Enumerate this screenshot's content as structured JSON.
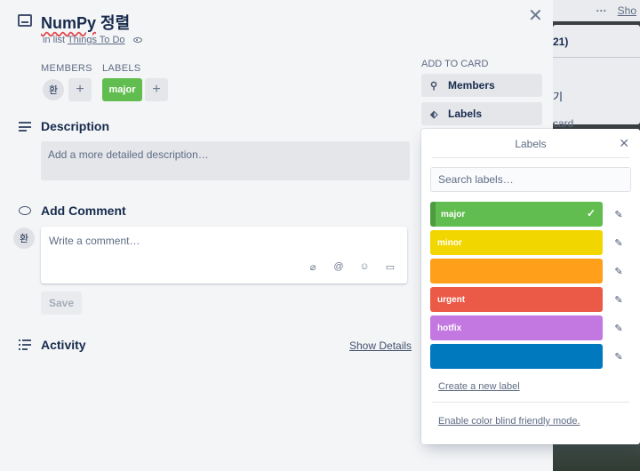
{
  "background": {
    "dots": "···",
    "show_link": "Sho",
    "list_title": "21)",
    "list_line2": "기",
    "list_line3": "card"
  },
  "card": {
    "title_word": "NumPy",
    "title_rest": "정렬",
    "in_list_prefix": "in list",
    "list_name": "Things To Do"
  },
  "members": {
    "label": "MEMBERS",
    "avatar_initial": "환"
  },
  "labels_section": {
    "label": "LABELS",
    "chip": "major",
    "chip_color": "#61bd4f"
  },
  "description": {
    "title": "Description",
    "placeholder": "Add a more detailed description…"
  },
  "comment": {
    "title": "Add Comment",
    "avatar_initial": "환",
    "placeholder": "Write a comment…",
    "save_label": "Save"
  },
  "activity": {
    "title": "Activity",
    "show_details": "Show Details"
  },
  "sidebar": {
    "add_to_card": "ADD TO CARD",
    "members_btn": "Members",
    "labels_btn": "Labels"
  },
  "popover": {
    "title": "Labels",
    "search_placeholder": "Search labels…",
    "labels": [
      {
        "name": "major",
        "color": "#61bd4f",
        "selected": true
      },
      {
        "name": "minor",
        "color": "#f2d600",
        "selected": false
      },
      {
        "name": "",
        "color": "#ff9f1a",
        "selected": false
      },
      {
        "name": "urgent",
        "color": "#eb5a46",
        "selected": false
      },
      {
        "name": "hotfix",
        "color": "#c377e0",
        "selected": false
      },
      {
        "name": "",
        "color": "#0079bf",
        "selected": false
      }
    ],
    "create_link": "Create a new label",
    "colorblind_link": "Enable color blind friendly mode."
  }
}
